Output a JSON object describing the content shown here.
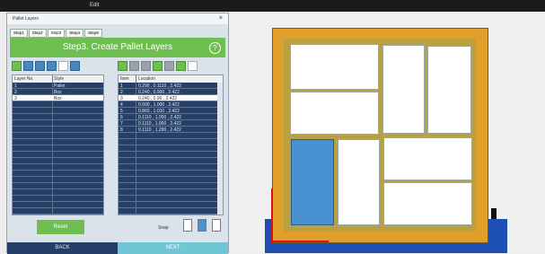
{
  "topbar": {
    "title": "Edit"
  },
  "window": {
    "title": "Pallet Layers",
    "close": "×",
    "tabs": [
      "Step1",
      "Step2",
      "Step3",
      "Step4",
      "Step5"
    ],
    "step_header": "Step3. Create Pallet Layers",
    "help": "?",
    "layers_table": {
      "headers": [
        "Layer No.",
        "Style"
      ],
      "rows": [
        {
          "no": "1",
          "style": "Pallet",
          "selected": false
        },
        {
          "no": "2",
          "style": "Box",
          "selected": false
        },
        {
          "no": "3",
          "style": "Box",
          "selected": true
        }
      ]
    },
    "items_table": {
      "headers": [
        "Item",
        "Location"
      ],
      "rows": [
        {
          "item": "1",
          "loc": "0.290 , 0.1110 , 2.422"
        },
        {
          "item": "2",
          "loc": "0.240 , 0.900 , 2.422"
        },
        {
          "item": "3",
          "loc": "0.240 , 0.90 , 2.422"
        },
        {
          "item": "4",
          "loc": "0.600 , 1.000 , 2.422"
        },
        {
          "item": "5",
          "loc": "0.860 , 1.010 , 2.422"
        },
        {
          "item": "6",
          "loc": "0.1110 , 1.050 , 2.422"
        },
        {
          "item": "7",
          "loc": "0.1110 , 1.000 , 2.422"
        },
        {
          "item": "8",
          "loc": "0.1110 , 1.290 , 2.422"
        }
      ]
    },
    "reset_label": "Reset",
    "snap_label": "Snap",
    "back_label": "BACK",
    "next_label": "NEXT"
  },
  "colors": {
    "accent_green": "#6fbe52",
    "navy": "#243f67",
    "pallet": "#e19f2a",
    "selected_box": "#4a91d1"
  }
}
